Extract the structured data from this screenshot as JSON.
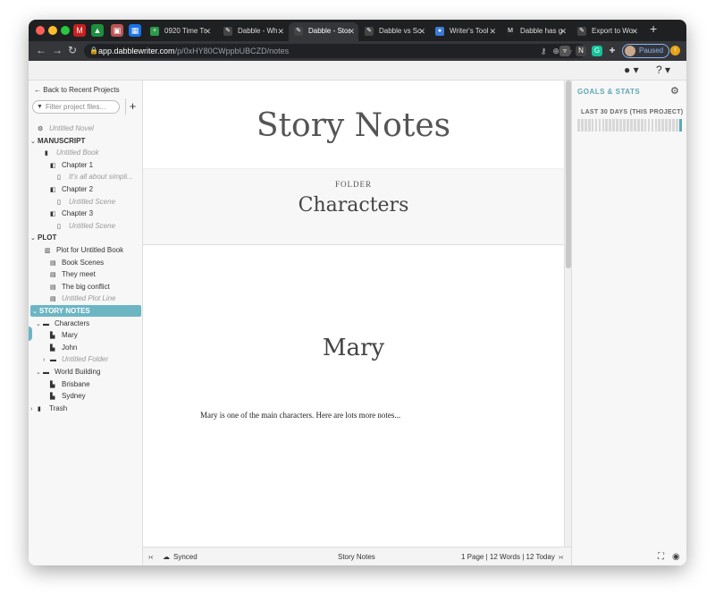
{
  "browser": {
    "tabs": [
      {
        "label": "0920 Time Tr",
        "fav": "#2e9a4b",
        "glyph": "+"
      },
      {
        "label": "Dabble - Wh",
        "fav": "#444",
        "glyph": "✎"
      },
      {
        "label": "Dabble - Stor",
        "fav": "#444",
        "glyph": "✎",
        "active": true
      },
      {
        "label": "Dabble vs Sc",
        "fav": "#444",
        "glyph": "✎"
      },
      {
        "label": "Writer's Tool",
        "fav": "#3a7bd5",
        "glyph": "●"
      },
      {
        "label": "Dabble has g",
        "fav": "#222",
        "glyph": "M"
      },
      {
        "label": "Export to Wo",
        "fav": "#444",
        "glyph": "✎"
      }
    ],
    "url_host": "app.dabblewriter.com",
    "url_path": "/p/0xHY80CWppbUBCZD/notes",
    "profile_status": "Paused"
  },
  "sidebar": {
    "back_label": "Back to Recent Projects",
    "filter_placeholder": "Filter project files...",
    "tree": [
      {
        "label": "Untitled Novel",
        "icon": "⚙",
        "indent": 10,
        "italic": true,
        "header": false,
        "caret": ""
      },
      {
        "label": "MANUSCRIPT",
        "icon": "",
        "indent": 2,
        "italic": false,
        "header": true,
        "caret": "⌄"
      },
      {
        "label": "Untitled Book",
        "icon": "▮",
        "indent": 18,
        "italic": true,
        "header": false,
        "caret": ""
      },
      {
        "label": "Chapter 1",
        "icon": "◧",
        "indent": 24,
        "italic": false,
        "header": false,
        "caret": ""
      },
      {
        "label": "It's all about simpli...",
        "icon": "▯",
        "indent": 32,
        "italic": true,
        "header": false,
        "caret": ""
      },
      {
        "label": "Chapter 2",
        "icon": "◧",
        "indent": 24,
        "italic": false,
        "header": false,
        "caret": ""
      },
      {
        "label": "Untitled Scene",
        "icon": "▯",
        "indent": 32,
        "italic": true,
        "header": false,
        "caret": ""
      },
      {
        "label": "Chapter 3",
        "icon": "◧",
        "indent": 24,
        "italic": false,
        "header": false,
        "caret": ""
      },
      {
        "label": "Untitled Scene",
        "icon": "▯",
        "indent": 32,
        "italic": true,
        "header": false,
        "caret": ""
      },
      {
        "label": "PLOT",
        "icon": "",
        "indent": 2,
        "italic": false,
        "header": true,
        "caret": "⌄"
      },
      {
        "label": "Plot for Untitled Book",
        "icon": "▥",
        "indent": 18,
        "italic": false,
        "header": false,
        "caret": ""
      },
      {
        "label": "Book Scenes",
        "icon": "▤",
        "indent": 24,
        "italic": false,
        "header": false,
        "caret": ""
      },
      {
        "label": "They meet",
        "icon": "▤",
        "indent": 24,
        "italic": false,
        "header": false,
        "caret": ""
      },
      {
        "label": "The big conflict",
        "icon": "▤",
        "indent": 24,
        "italic": false,
        "header": false,
        "caret": ""
      },
      {
        "label": "Untitled Plot Line",
        "icon": "▤",
        "indent": 24,
        "italic": true,
        "header": false,
        "caret": ""
      },
      {
        "label": "STORY NOTES",
        "icon": "",
        "indent": 2,
        "italic": false,
        "header": true,
        "caret": "⌄",
        "selected": true
      },
      {
        "label": "Characters",
        "icon": "▬",
        "indent": 8,
        "italic": false,
        "header": false,
        "caret": "⌄"
      },
      {
        "label": "Mary",
        "icon": "▙",
        "indent": 24,
        "italic": false,
        "header": false,
        "caret": ""
      },
      {
        "label": "John",
        "icon": "▙",
        "indent": 24,
        "italic": false,
        "header": false,
        "caret": ""
      },
      {
        "label": "Untitled Folder",
        "icon": "▬",
        "indent": 16,
        "italic": true,
        "header": false,
        "caret": "›"
      },
      {
        "label": "World Building",
        "icon": "▬",
        "indent": 8,
        "italic": false,
        "header": false,
        "caret": "⌄"
      },
      {
        "label": "Brisbane",
        "icon": "▙",
        "indent": 24,
        "italic": false,
        "header": false,
        "caret": ""
      },
      {
        "label": "Sydney",
        "icon": "▙",
        "indent": 24,
        "italic": false,
        "header": false,
        "caret": ""
      },
      {
        "label": "Trash",
        "icon": "▮",
        "indent": 2,
        "italic": false,
        "header": false,
        "caret": "›"
      }
    ]
  },
  "editor": {
    "title": "Story Notes",
    "folder_label": "FOLDER",
    "folder_name": "Characters",
    "note_title": "Mary",
    "note_body": "Mary is one of the main characters. Here are lots more notes..."
  },
  "status": {
    "sync": "Synced",
    "doc_name": "Story Notes",
    "stats": "1 Page | 12 Words | 12 Today"
  },
  "goals": {
    "title": "GOALS & STATS",
    "subtitle": "LAST 30 DAYS (THIS PROJECT)",
    "days": 30
  }
}
